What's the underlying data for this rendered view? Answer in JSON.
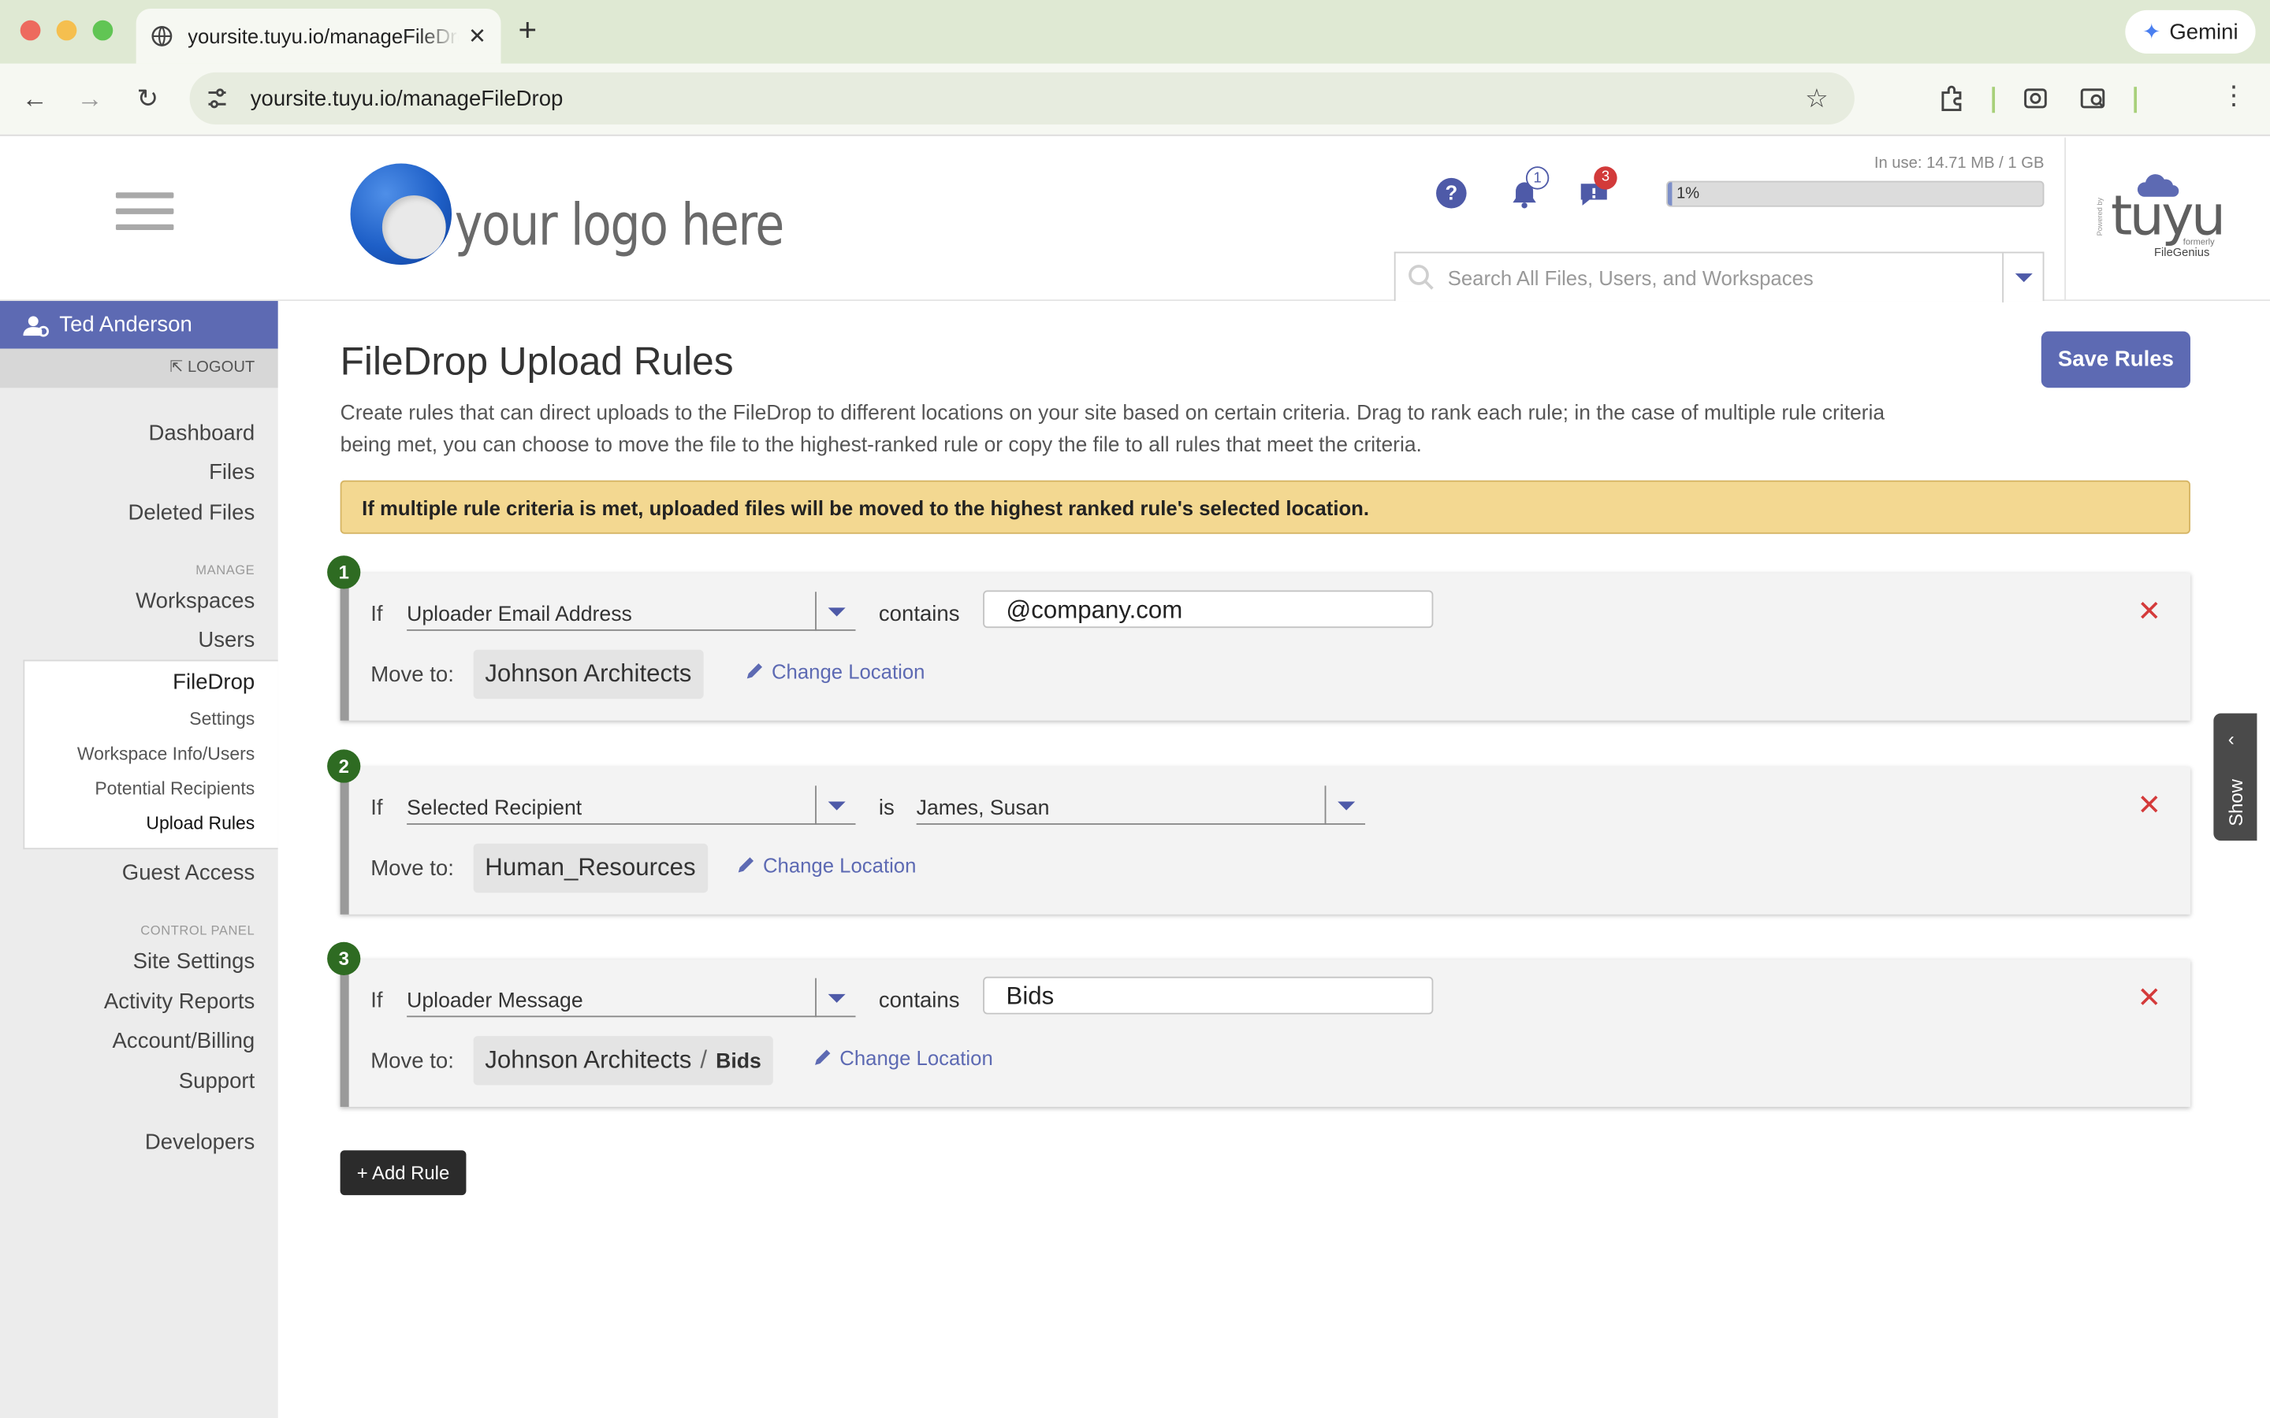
{
  "browser": {
    "tab_title": "yoursite.tuyu.io/manageFileDrop",
    "url": "yoursite.tuyu.io/manageFileDrop",
    "gemini_label": "Gemini"
  },
  "header": {
    "logo_text": "your logo here",
    "notifications_count": "1",
    "messages_count": "3",
    "usage_label": "In use: 14.71 MB / 1 GB",
    "usage_percent_text": "1%",
    "usage_fraction": 0.01,
    "search_placeholder": "Search All Files, Users, and Workspaces",
    "brand": {
      "powered_by": "Powered by",
      "name": "tuyu",
      "formerly": "formerly",
      "former_name": "FileGenius"
    }
  },
  "sidebar": {
    "user_name": "Ted Anderson",
    "logout": "LOGOUT",
    "items": [
      "Dashboard",
      "Files",
      "Deleted Files"
    ],
    "manage_label": "MANAGE",
    "manage_items": [
      "Workspaces",
      "Users"
    ],
    "filedrop": {
      "label": "FileDrop",
      "subitems": [
        "Settings",
        "Workspace Info/Users",
        "Potential Recipients",
        "Upload Rules"
      ]
    },
    "guest_access": "Guest Access",
    "control_panel_label": "CONTROL PANEL",
    "control_items": [
      "Site Settings",
      "Activity Reports",
      "Account/Billing",
      "Support"
    ],
    "developers": "Developers"
  },
  "main": {
    "title": "FileDrop Upload Rules",
    "save_label": "Save Rules",
    "description": "Create rules that can direct uploads to the FileDrop to different locations on your site based on certain criteria. Drag to rank each rule; in the case of multiple rule criteria being met, you can choose to move the file to the highest-ranked rule or copy the file to all rules that meet the criteria.",
    "alert": "If multiple rule criteria is met, uploaded files will be moved to the highest ranked rule's selected location.",
    "if_label": "If",
    "move_to_label": "Move to:",
    "change_location_label": "Change Location",
    "rules": [
      {
        "number": "1",
        "field": "Uploader Email Address",
        "operator": "contains",
        "value": "@company.com",
        "location": "Johnson Architects",
        "sublocation": ""
      },
      {
        "number": "2",
        "field": "Selected Recipient",
        "operator": "is",
        "value": "James, Susan",
        "location": "Human_Resources",
        "sublocation": ""
      },
      {
        "number": "3",
        "field": "Uploader Message",
        "operator": "contains",
        "value": "Bids",
        "location": "Johnson Architects",
        "sublocation": "Bids"
      }
    ],
    "add_rule_label": "+ Add Rule",
    "path_separator": "/"
  },
  "side_panel": {
    "show_label": "Show"
  },
  "colors": {
    "accent": "#5d6ab3",
    "alert_bg": "#f3d891",
    "rule_number": "#2e6b22",
    "delete": "#d43a3a"
  }
}
